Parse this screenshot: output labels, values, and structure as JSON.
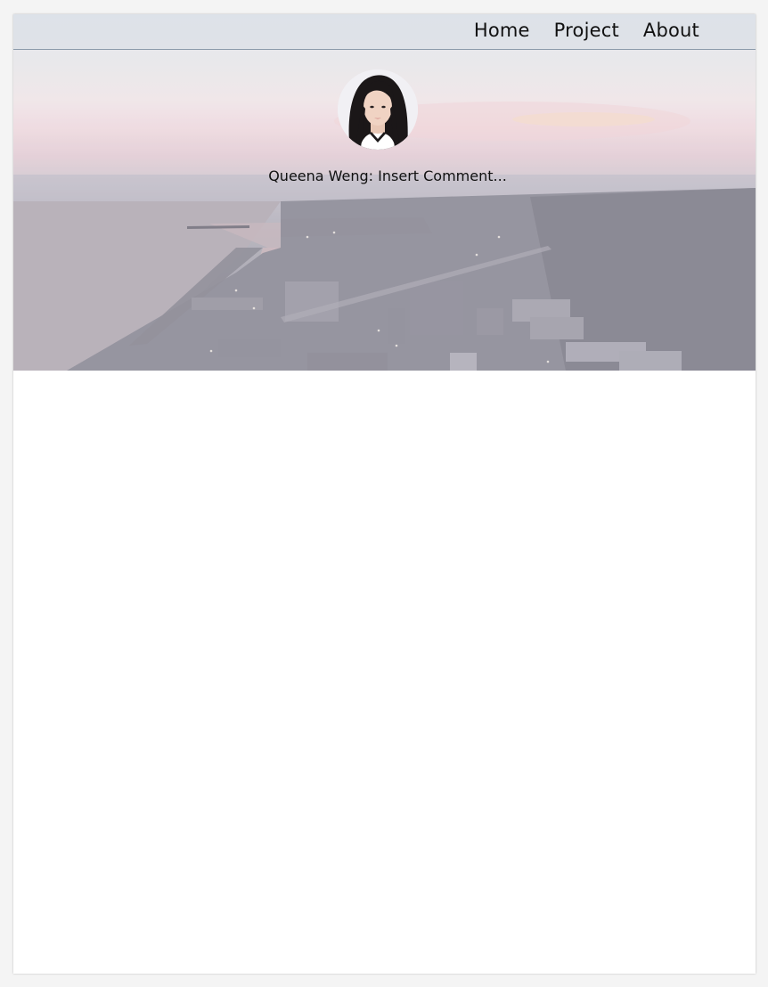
{
  "nav": {
    "items": [
      {
        "label": "Home"
      },
      {
        "label": "Project"
      },
      {
        "label": "About"
      }
    ]
  },
  "profile": {
    "tagline": "Queena Weng: Insert Comment..."
  },
  "icons": {
    "avatar": "profile-photo"
  }
}
